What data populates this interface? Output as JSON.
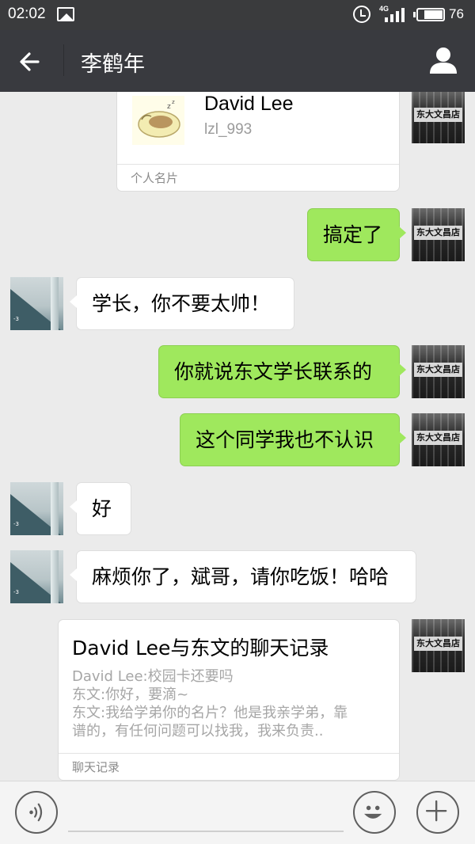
{
  "status_bar": {
    "time": "02:02",
    "network": "4G",
    "battery": "76",
    "battery_level": 0.76
  },
  "header": {
    "title": "李鹤年",
    "back_icon": "back-arrow-icon",
    "profile_icon": "person-icon"
  },
  "messages": [
    {
      "type": "contact_card",
      "direction": "out",
      "name": "David Lee",
      "wechat_id": "lzl_993",
      "label": "个人名片"
    },
    {
      "type": "text",
      "direction": "out",
      "text": "搞定了"
    },
    {
      "type": "text",
      "direction": "in",
      "text": "学长，你不要太帅！"
    },
    {
      "type": "text",
      "direction": "out",
      "text": "你就说东文学长联系的"
    },
    {
      "type": "text",
      "direction": "out",
      "text": "这个同学我也不认识"
    },
    {
      "type": "text",
      "direction": "in",
      "text": "好"
    },
    {
      "type": "text",
      "direction": "in",
      "text": "麻烦你了，斌哥，请你吃饭！哈哈"
    },
    {
      "type": "chat_record",
      "direction": "out",
      "title": "David Lee与东文的聊天记录",
      "lines": [
        "David Lee:校园卡还要吗",
        "东文:你好，要滴~",
        "东文:我给学弟你的名片？他是我亲学弟，靠",
        "谱的，有任何问题可以找我，我来负责.."
      ],
      "label": "聊天记录"
    }
  ],
  "avatars": {
    "self_sign_text": "东大文昌店"
  },
  "input_bar": {
    "placeholder": "",
    "voice_icon": "voice-icon",
    "emoji_icon": "emoji-icon",
    "more_icon": "plus-icon"
  },
  "colors": {
    "header_bg": "#393a3f",
    "chat_bg": "#ebebeb",
    "outgoing_bubble": "#9fe85d",
    "incoming_bubble": "#ffffff"
  }
}
